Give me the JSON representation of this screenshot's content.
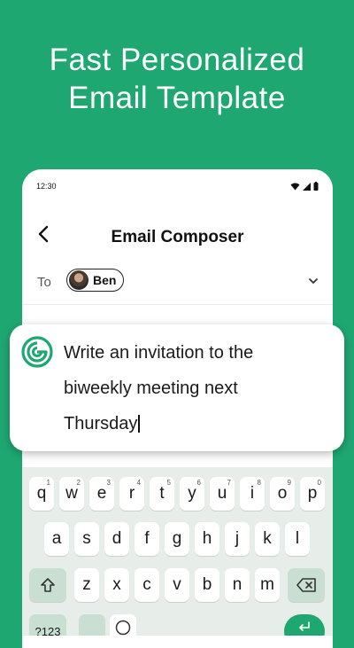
{
  "headline": {
    "line1": "Fast Personalized",
    "line2": "Email Template"
  },
  "status_bar": {
    "time": "12:30",
    "icons": [
      "wifi-icon",
      "signal-icon",
      "battery-icon"
    ]
  },
  "app_bar": {
    "back_icon": "back-arrow-icon",
    "title": "Email Composer"
  },
  "recipient": {
    "label": "To",
    "chip_name": "Ben",
    "dropdown_icon": "chevron-down-icon"
  },
  "prompt": {
    "logo_icon": "assistant-logo-icon",
    "line1": "Write an invitation to the",
    "line2": "biweekly meeting next",
    "line3": "Thursday"
  },
  "keyboard": {
    "row1": [
      "q",
      "w",
      "e",
      "r",
      "t",
      "y",
      "u",
      "i",
      "o",
      "p"
    ],
    "row1_hints": [
      "1",
      "2",
      "3",
      "4",
      "5",
      "6",
      "7",
      "8",
      "9",
      "0"
    ],
    "row2": [
      "a",
      "s",
      "d",
      "f",
      "g",
      "h",
      "j",
      "k",
      "l"
    ],
    "row3": [
      "z",
      "x",
      "c",
      "v",
      "b",
      "n",
      "m"
    ],
    "row4_symbols_label": "?123",
    "shift_icon": "shift-icon",
    "backspace_icon": "backspace-icon",
    "emoji_icon": "emoji-icon",
    "enter_icon": "enter-icon"
  },
  "colors": {
    "brand_green": "#1fa772",
    "special_key": "#c9dfd2",
    "keyboard_bg": "#e7ede9"
  }
}
